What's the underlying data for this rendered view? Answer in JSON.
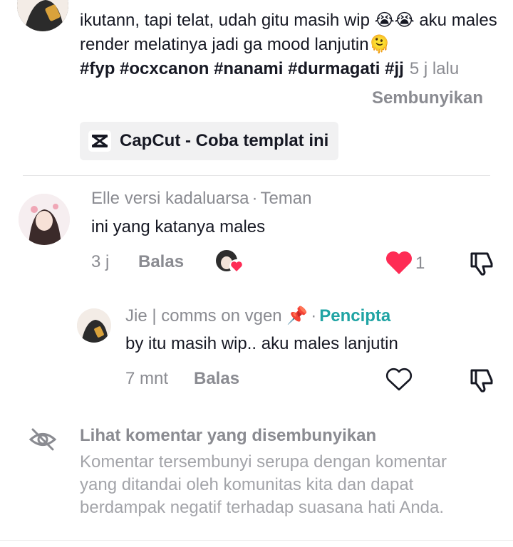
{
  "post": {
    "caption_text": "ikutann, tapi telat, udah gitu masih wip 😭😭 aku males render melatinya jadi ga mood lanjutin🫠",
    "hashtags": "#fyp #ocxcanon #nanami #durmagati #jj",
    "time": "5 j lalu",
    "hide_label": "Sembunyikan",
    "capcut_label": "CapCut - Coba templat ini"
  },
  "comments": [
    {
      "username": "Elle versi kadaluarsa",
      "separator": "·",
      "relation": "Teman",
      "text": "ini yang katanya males",
      "time": "3 j",
      "reply_label": "Balas",
      "like_count": "1",
      "liked": true
    },
    {
      "username": "Jie | comms on vgen 📌",
      "separator": "·",
      "relation": "Pencipta",
      "text": "by itu masih wip.. aku males lanjutin",
      "time": "7 mnt",
      "reply_label": "Balas",
      "liked": false
    }
  ],
  "hidden_comments": {
    "title": "Lihat komentar yang disembunyikan",
    "description": "Komentar tersembunyi serupa dengan komentar yang ditandai oleh komunitas kita dan dapat berdampak negatif terhadap suasana hati Anda."
  },
  "colors": {
    "like_red": "#fe2c55",
    "creator_teal": "#20a4a4",
    "secondary_gray": "#8a8b91"
  }
}
